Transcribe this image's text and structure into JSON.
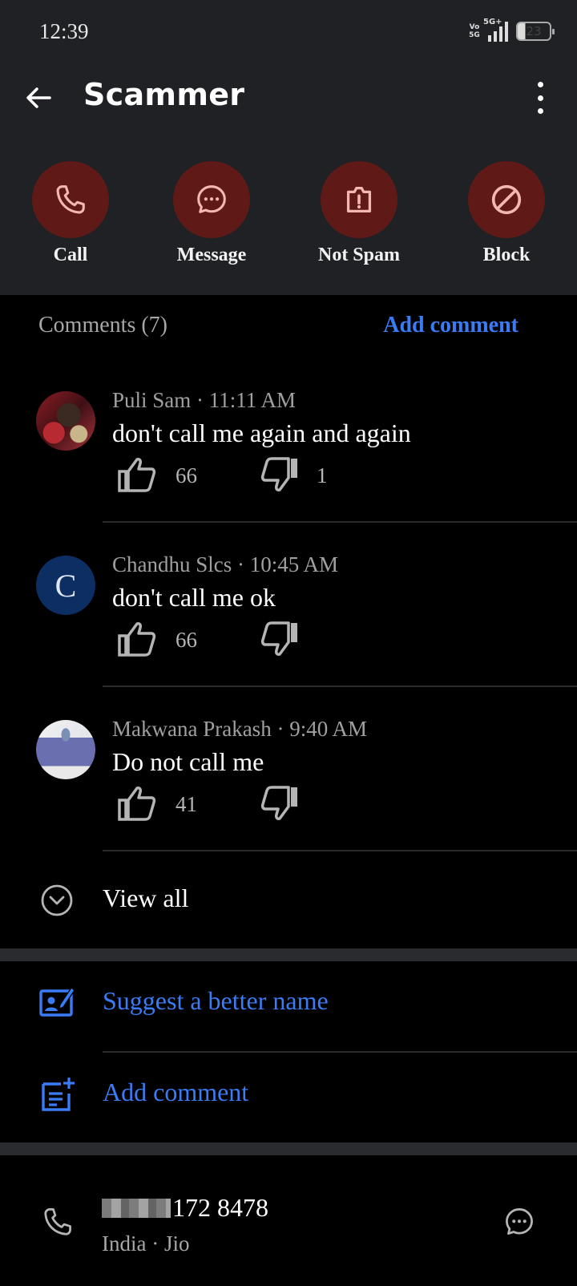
{
  "status_bar": {
    "time": "12:39",
    "network": "5G+",
    "volte": "Vo 5G",
    "battery": "23"
  },
  "header": {
    "title": "Scammer"
  },
  "actions": [
    {
      "label": "Call",
      "icon": "phone-icon"
    },
    {
      "label": "Message",
      "icon": "chat-bubble-icon"
    },
    {
      "label": "Not Spam",
      "icon": "report-icon"
    },
    {
      "label": "Block",
      "icon": "block-icon"
    }
  ],
  "comments_section": {
    "title": "Comments (7)",
    "add_comment_label": "Add comment",
    "items": [
      {
        "author": "Puli Sam",
        "time": "11:11 AM",
        "text": "don't call me again and again",
        "likes": "66",
        "dislikes": "1",
        "avatar": "photo"
      },
      {
        "author": "Chandhu Slcs",
        "time": "10:45 AM",
        "text": "don't call me ok",
        "likes": "66",
        "dislikes": "",
        "avatar_letter": "C"
      },
      {
        "author": "Makwana Prakash",
        "time": "9:40 AM",
        "text": "Do not call me",
        "likes": "41",
        "dislikes": "",
        "avatar": "photo"
      }
    ],
    "view_all_label": "View all"
  },
  "links": {
    "suggest_name": "Suggest a better name",
    "add_comment": "Add comment"
  },
  "contact": {
    "number_visible": "172 8478",
    "country": "India",
    "carrier": "Jio"
  },
  "colors": {
    "accent": "#3a7cf6",
    "action_circle": "#5f1a17",
    "header_bg": "#202124",
    "icon_pink": "#f3b8b2"
  }
}
